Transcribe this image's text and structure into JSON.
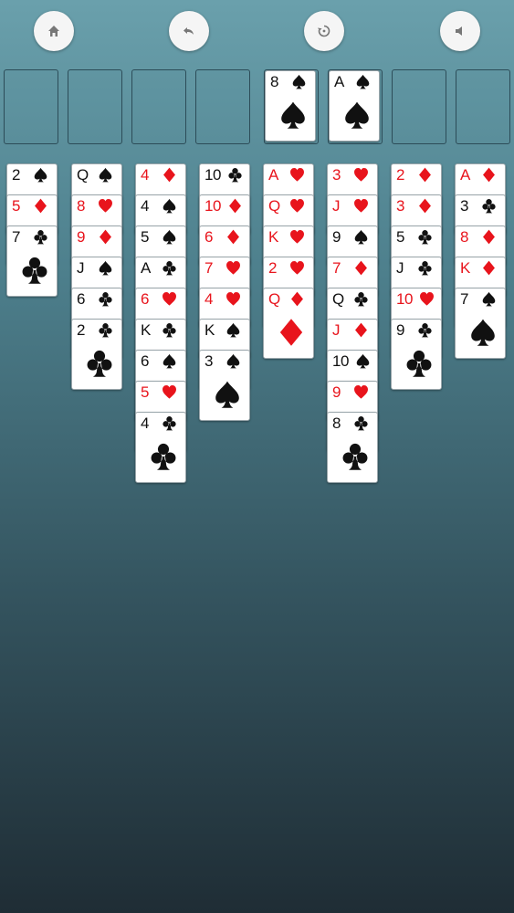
{
  "toolbar": {
    "buttons": [
      {
        "name": "home-button",
        "icon": "home-icon"
      },
      {
        "name": "undo-button",
        "icon": "undo-icon"
      },
      {
        "name": "restart-button",
        "icon": "restart-icon"
      },
      {
        "name": "sound-button",
        "icon": "speaker-icon"
      }
    ]
  },
  "colors": {
    "red": "#e8141c",
    "black": "#111111"
  },
  "freecells": [
    null,
    null,
    null,
    null
  ],
  "foundations": [
    {
      "rank": "8",
      "suit": "spades"
    },
    {
      "rank": "A",
      "suit": "spades"
    },
    null,
    null
  ],
  "tableau": [
    [
      {
        "rank": "2",
        "suit": "spades"
      },
      {
        "rank": "5",
        "suit": "diamonds"
      },
      {
        "rank": "7",
        "suit": "clubs"
      }
    ],
    [
      {
        "rank": "Q",
        "suit": "spades"
      },
      {
        "rank": "8",
        "suit": "hearts"
      },
      {
        "rank": "9",
        "suit": "diamonds"
      },
      {
        "rank": "J",
        "suit": "spades"
      },
      {
        "rank": "6",
        "suit": "clubs"
      },
      {
        "rank": "2",
        "suit": "clubs"
      }
    ],
    [
      {
        "rank": "4",
        "suit": "diamonds"
      },
      {
        "rank": "4",
        "suit": "spades"
      },
      {
        "rank": "5",
        "suit": "spades"
      },
      {
        "rank": "A",
        "suit": "clubs"
      },
      {
        "rank": "6",
        "suit": "hearts"
      },
      {
        "rank": "K",
        "suit": "clubs"
      },
      {
        "rank": "6",
        "suit": "spades"
      },
      {
        "rank": "5",
        "suit": "hearts"
      },
      {
        "rank": "4",
        "suit": "clubs"
      }
    ],
    [
      {
        "rank": "10",
        "suit": "clubs"
      },
      {
        "rank": "10",
        "suit": "diamonds"
      },
      {
        "rank": "6",
        "suit": "diamonds"
      },
      {
        "rank": "7",
        "suit": "hearts"
      },
      {
        "rank": "4",
        "suit": "hearts"
      },
      {
        "rank": "K",
        "suit": "spades"
      },
      {
        "rank": "3",
        "suit": "spades"
      }
    ],
    [
      {
        "rank": "A",
        "suit": "hearts"
      },
      {
        "rank": "Q",
        "suit": "hearts"
      },
      {
        "rank": "K",
        "suit": "hearts"
      },
      {
        "rank": "2",
        "suit": "hearts"
      },
      {
        "rank": "Q",
        "suit": "diamonds"
      }
    ],
    [
      {
        "rank": "3",
        "suit": "hearts"
      },
      {
        "rank": "J",
        "suit": "hearts"
      },
      {
        "rank": "9",
        "suit": "spades"
      },
      {
        "rank": "7",
        "suit": "diamonds"
      },
      {
        "rank": "Q",
        "suit": "clubs"
      },
      {
        "rank": "J",
        "suit": "diamonds"
      },
      {
        "rank": "10",
        "suit": "spades"
      },
      {
        "rank": "9",
        "suit": "hearts"
      },
      {
        "rank": "8",
        "suit": "clubs"
      }
    ],
    [
      {
        "rank": "2",
        "suit": "diamonds"
      },
      {
        "rank": "3",
        "suit": "diamonds"
      },
      {
        "rank": "5",
        "suit": "clubs"
      },
      {
        "rank": "J",
        "suit": "clubs"
      },
      {
        "rank": "10",
        "suit": "hearts"
      },
      {
        "rank": "9",
        "suit": "clubs"
      }
    ],
    [
      {
        "rank": "A",
        "suit": "diamonds"
      },
      {
        "rank": "3",
        "suit": "clubs"
      },
      {
        "rank": "8",
        "suit": "diamonds"
      },
      {
        "rank": "K",
        "suit": "diamonds"
      },
      {
        "rank": "7",
        "suit": "spades"
      }
    ]
  ]
}
